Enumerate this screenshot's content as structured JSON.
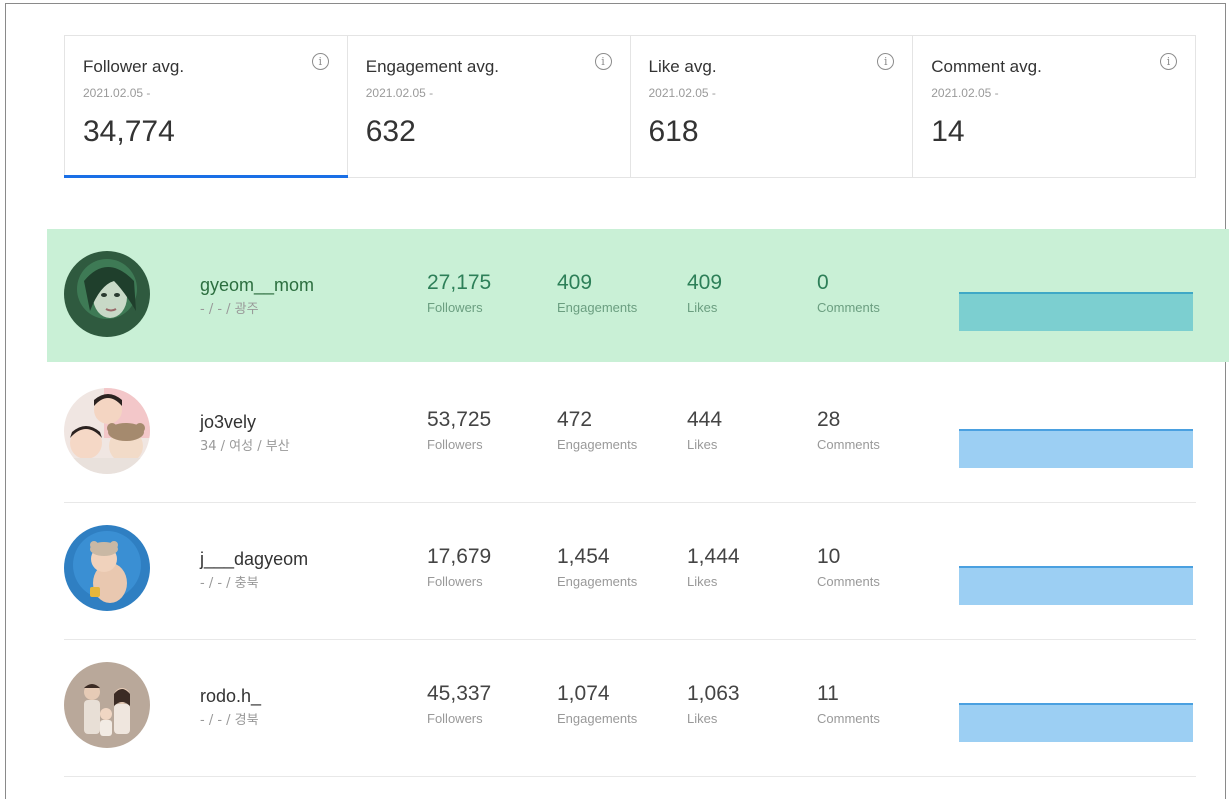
{
  "stats": [
    {
      "title": "Follower avg.",
      "date": "2021.02.05 -",
      "value": "34,774",
      "active": true
    },
    {
      "title": "Engagement avg.",
      "date": "2021.02.05 -",
      "value": "632",
      "active": false
    },
    {
      "title": "Like avg.",
      "date": "2021.02.05 -",
      "value": "618",
      "active": false
    },
    {
      "title": "Comment avg.",
      "date": "2021.02.05 -",
      "value": "14",
      "active": false
    }
  ],
  "info_glyph": "i",
  "labels": {
    "followers": "Followers",
    "engagements": "Engagements",
    "likes": "Likes",
    "comments": "Comments"
  },
  "rows": [
    {
      "name": "gyeom__mom",
      "meta": "- / - / 광주",
      "followers": "27,175",
      "engagements": "409",
      "likes": "409",
      "comments": "0",
      "highlight": true
    },
    {
      "name": "jo3vely",
      "meta": "34 / 여성 / 부산",
      "followers": "53,725",
      "engagements": "472",
      "likes": "444",
      "comments": "28",
      "highlight": false
    },
    {
      "name": "j___dagyeom",
      "meta": "- / - / 충북",
      "followers": "17,679",
      "engagements": "1,454",
      "likes": "1,444",
      "comments": "10",
      "highlight": false
    },
    {
      "name": "rodo.h_",
      "meta": "- / - / 경북",
      "followers": "45,337",
      "engagements": "1,074",
      "likes": "1,063",
      "comments": "11",
      "highlight": false
    }
  ],
  "colors": {
    "accent": "#1a6fe6",
    "highlight_bg": "#c9f0d6",
    "spark_fill": "#9ccff3",
    "spark_line": "#4aa0e0",
    "spark_fill_highlight": "#7ccfd0",
    "spark_line_highlight": "#3fa8c6"
  }
}
